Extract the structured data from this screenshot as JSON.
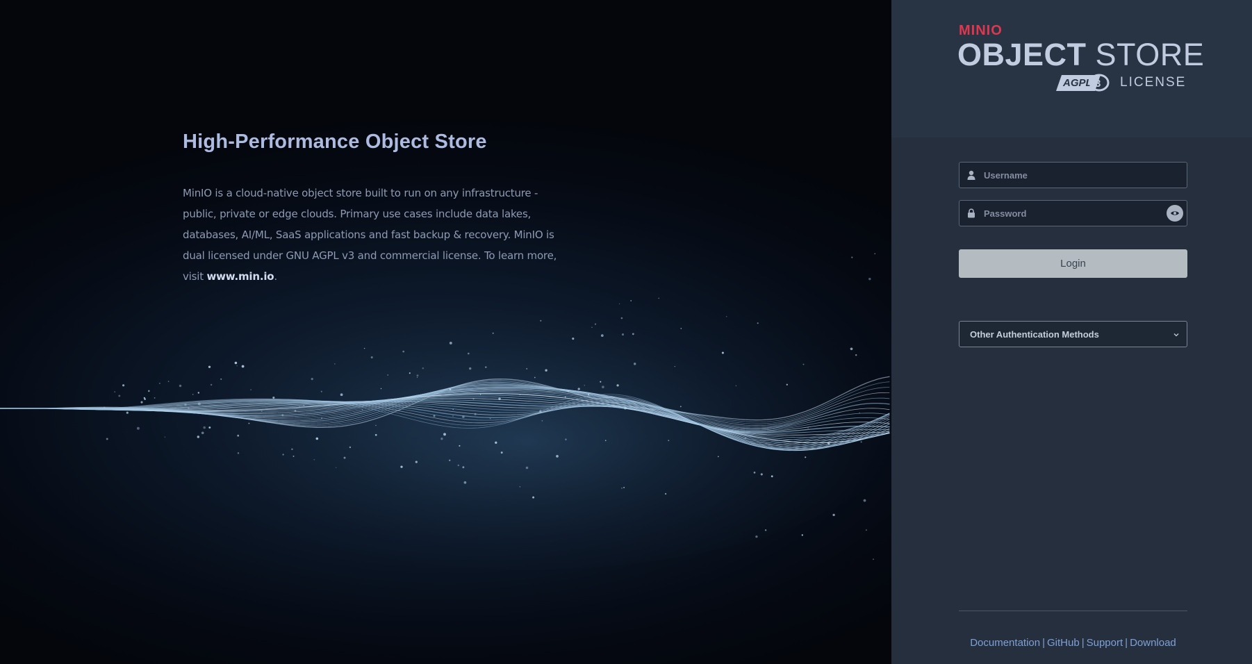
{
  "hero": {
    "title": "High-Performance Object Store",
    "description_before_link": "MinIO is a cloud-native object store built to run on any infrastructure - public, private or edge clouds. Primary use cases include data lakes, databases, AI/ML, SaaS applications and fast backup & recovery. MinIO is dual licensed under GNU AGPL v3 and commercial license. To learn more, visit ",
    "link_text": "www.min.io",
    "description_after_link": ".",
    "background_image": "abstract-wave-lines"
  },
  "brand": {
    "wordmark": "MINIO",
    "product_bold": "OBJECT",
    "product_light": " STORE",
    "license_badge": "AGPL v3",
    "license_text": "LICENSE",
    "accent_color": "#e0374e"
  },
  "login": {
    "username_placeholder": "Username",
    "password_placeholder": "Password",
    "username_icon": "user-icon",
    "password_icon": "lock-icon",
    "show_password_icon": "eye-icon",
    "login_label": "Login",
    "other_methods_label": "Other Authentication Methods",
    "other_methods_icon": "chevron-down-icon"
  },
  "footer": {
    "links": [
      "Documentation",
      "GitHub",
      "Support",
      "Download"
    ],
    "separator": "|",
    "link_color": "#7ea0d6"
  }
}
